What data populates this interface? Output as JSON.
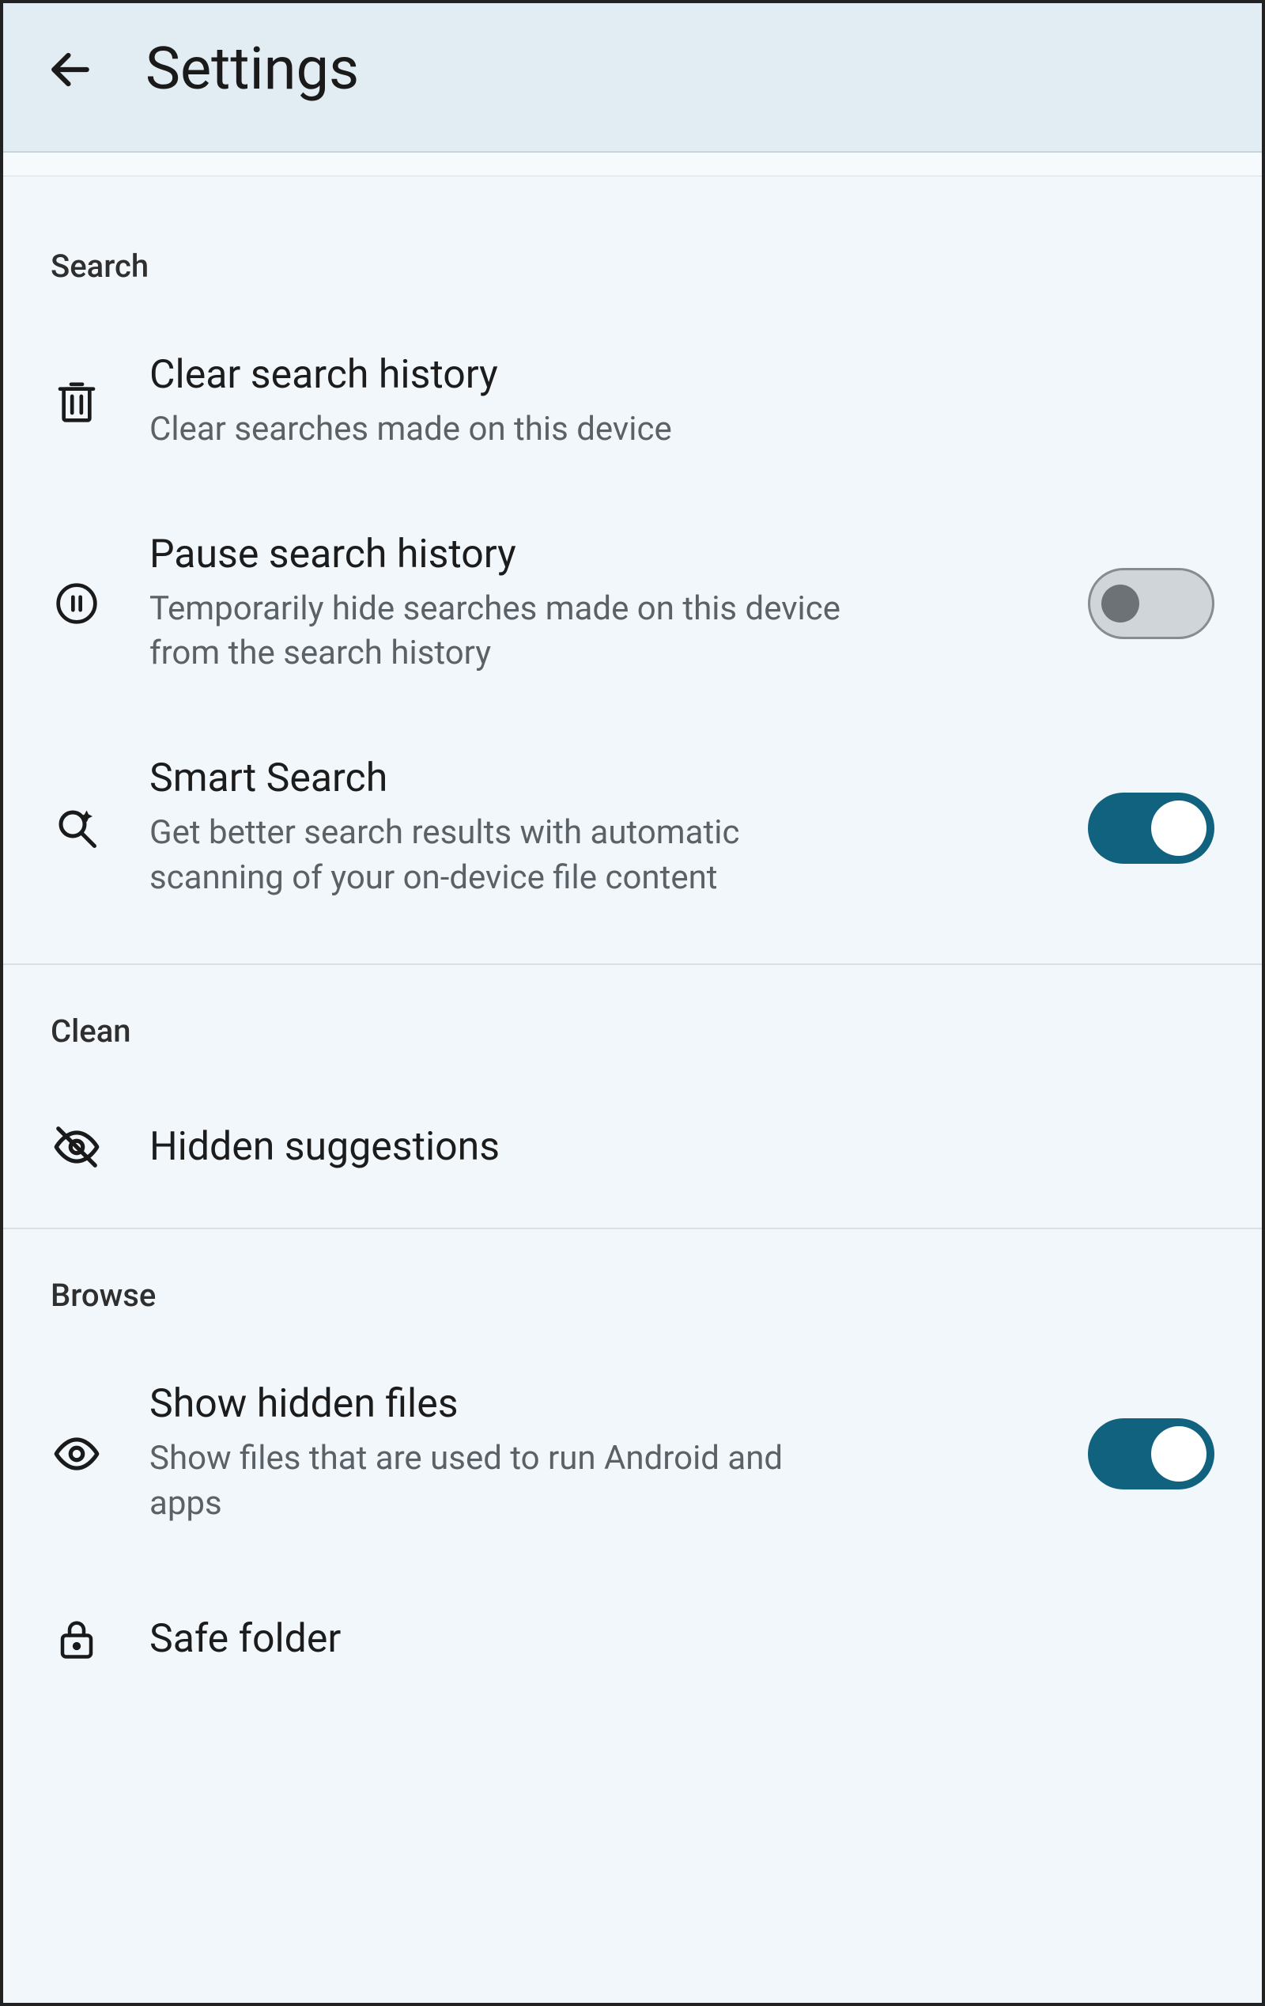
{
  "header": {
    "title": "Settings"
  },
  "sections": {
    "search": {
      "label": "Search",
      "clear": {
        "title": "Clear search history",
        "sub": "Clear searches made on this device"
      },
      "pause": {
        "title": "Pause search history",
        "sub": "Temporarily hide searches made on this device from the search history",
        "enabled": false
      },
      "smart": {
        "title": "Smart Search",
        "sub": "Get better search results with automatic scanning of your on-device file content",
        "enabled": true
      }
    },
    "clean": {
      "label": "Clean",
      "hidden": {
        "title": "Hidden suggestions"
      }
    },
    "browse": {
      "label": "Browse",
      "showHidden": {
        "title": "Show hidden files",
        "sub": "Show files that are used to run Android and apps",
        "enabled": true
      },
      "safe": {
        "title": "Safe folder"
      }
    }
  }
}
